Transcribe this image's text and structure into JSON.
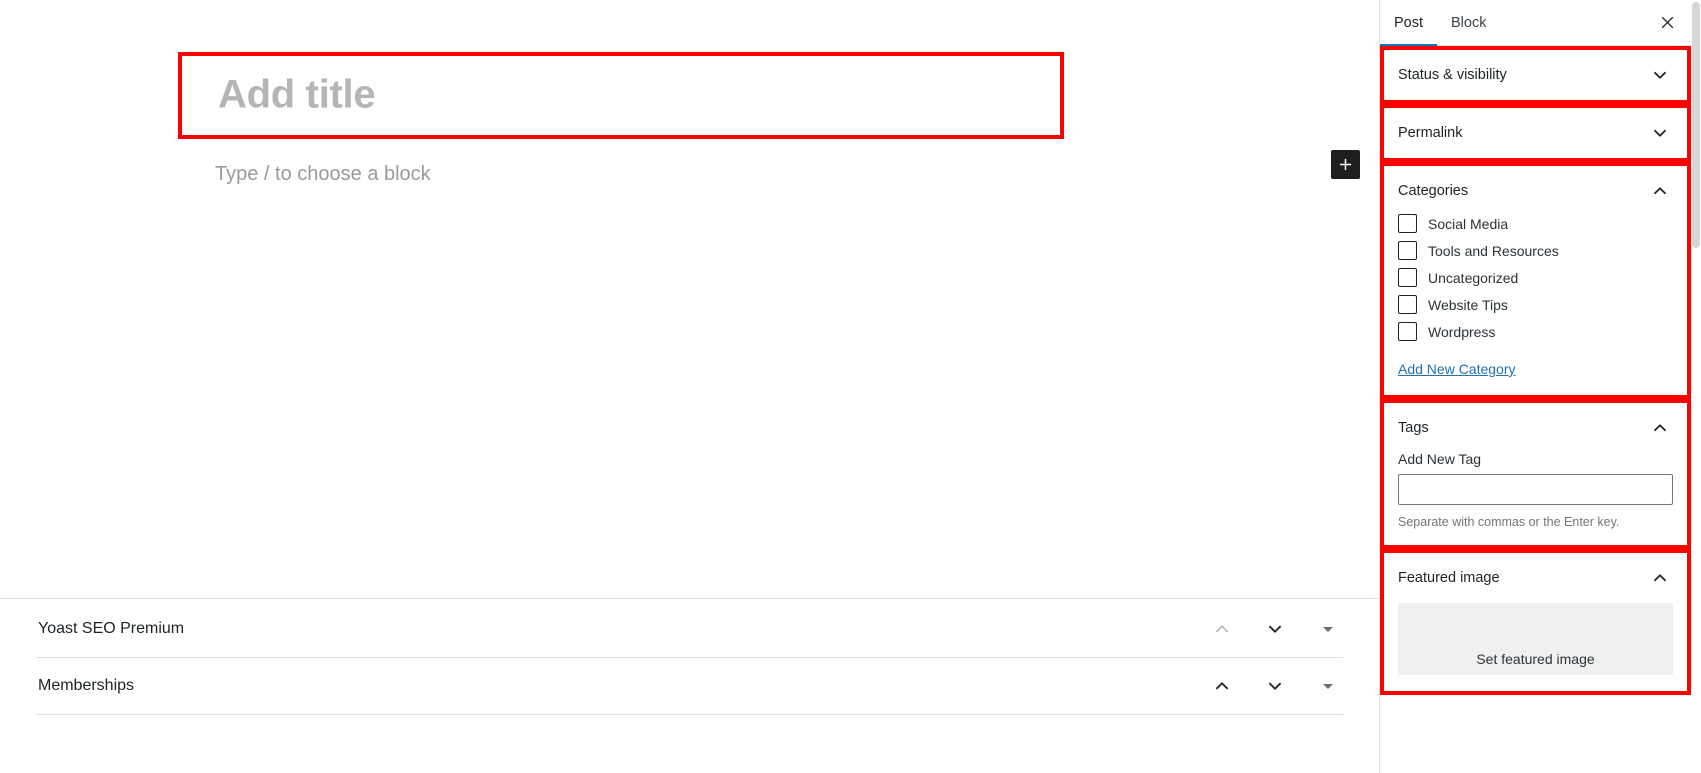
{
  "editor": {
    "title_placeholder": "Add title",
    "block_placeholder": "Type / to choose a block",
    "add_block_label": "+",
    "meta_panels": [
      {
        "title": "Yoast SEO Premium"
      },
      {
        "title": "Memberships"
      }
    ]
  },
  "sidebar": {
    "tabs": [
      {
        "label": "Post",
        "active": true
      },
      {
        "label": "Block",
        "active": false
      }
    ],
    "close_label": "Close settings",
    "panels": {
      "status": {
        "title": "Status & visibility",
        "expanded": false
      },
      "permalink": {
        "title": "Permalink",
        "expanded": false
      },
      "categories": {
        "title": "Categories",
        "expanded": true,
        "items": [
          {
            "label": "Social Media",
            "checked": false
          },
          {
            "label": "Tools and Resources",
            "checked": false
          },
          {
            "label": "Uncategorized",
            "checked": false
          },
          {
            "label": "Website Tips",
            "checked": false
          },
          {
            "label": "Wordpress",
            "checked": false
          }
        ],
        "add_link": "Add New Category"
      },
      "tags": {
        "title": "Tags",
        "expanded": true,
        "field_label": "Add New Tag",
        "value": "",
        "placeholder": "",
        "help": "Separate with commas or the Enter key."
      },
      "featured_image": {
        "title": "Featured image",
        "expanded": true,
        "set_label": "Set featured image"
      }
    }
  },
  "colors": {
    "highlight": "#ff0000",
    "accent": "#007cba",
    "link": "#2271b1"
  }
}
